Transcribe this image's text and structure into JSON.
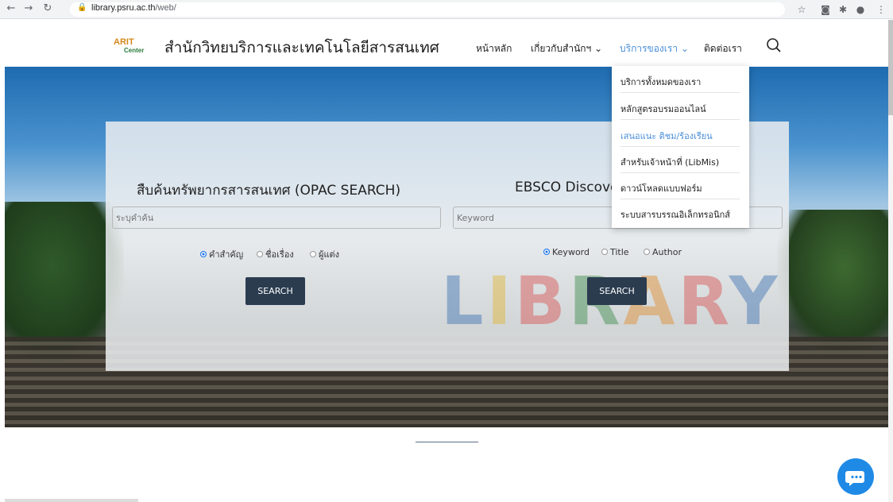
{
  "browser": {
    "url_host": "library.psru.ac.th",
    "url_path": "/web/"
  },
  "logo": {
    "line1": "ARIT",
    "line2": "Center"
  },
  "site_title": "สำนักวิทยบริการและเทคโนโลยีสารสนเทศ",
  "menu": {
    "home": "หน้าหลัก",
    "about": "เกี่ยวกับสำนักฯ ⌄",
    "services": "บริการของเรา ⌄",
    "contact": "ติดต่อเรา"
  },
  "dropdown": {
    "items": [
      "บริการทั้งหมดของเรา",
      "หลักสูตรอบรมออนไลน์",
      "เสนอแนะ ติชม/ร้องเรียน",
      "สำหรับเจ้าหน้าที่ (LibMis)",
      "ดาวน์โหลดแบบฟอร์ม",
      "ระบบสารบรรณอิเล็กทรอนิกส์"
    ]
  },
  "opac": {
    "title": "สืบค้นทรัพยากรสารสนเทศ (OPAC SEARCH)",
    "placeholder": "ระบุคำค้น",
    "options": [
      "คำสำคัญ",
      "ชื่อเรื่อง",
      "ผู้แต่ง"
    ],
    "selected": "คำสำคัญ",
    "button": "SEARCH"
  },
  "ebsco": {
    "title": "EBSCO Discove",
    "placeholder": "Keyword",
    "options": [
      "Keyword",
      "Title",
      "Author"
    ],
    "selected": "Keyword",
    "button": "SEARCH"
  },
  "hero_letters": "LIBRARY",
  "colors": {
    "accent_blue": "#4a8ed8",
    "button_dark": "#2b3c4f",
    "chat_blue": "#1f8ae6"
  }
}
